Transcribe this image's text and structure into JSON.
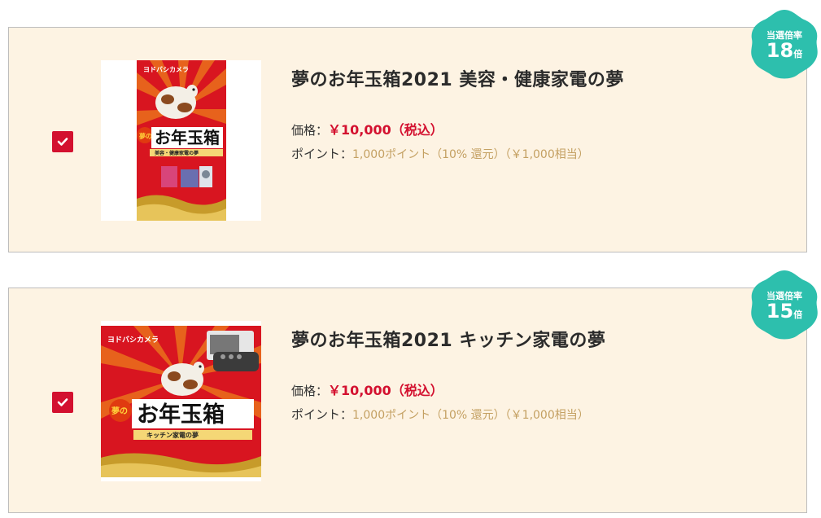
{
  "colors": {
    "accent_red": "#d3102f",
    "badge_teal": "#2dbfad",
    "card_bg": "#fdf3e3",
    "point_gold": "#c4a062"
  },
  "products": [
    {
      "checked": true,
      "title": "夢のお年玉箱2021 美容・健康家電の夢",
      "price_label": "価格：",
      "price_value": "￥10,000（税込）",
      "point_label": "ポイント：",
      "point_value": "1,000ポイント（10% 還元）（￥1,000相当）",
      "badge": {
        "label": "当選倍率",
        "number": "18",
        "unit": "倍"
      },
      "image": {
        "brand": "ヨドバシカメラ",
        "headline": "お年玉箱",
        "yume": "夢の",
        "subtitle": "美容・健康家電の夢"
      }
    },
    {
      "checked": true,
      "title": "夢のお年玉箱2021 キッチン家電の夢",
      "price_label": "価格：",
      "price_value": "￥10,000（税込）",
      "point_label": "ポイント：",
      "point_value": "1,000ポイント（10% 還元）（￥1,000相当）",
      "badge": {
        "label": "当選倍率",
        "number": "15",
        "unit": "倍"
      },
      "image": {
        "brand": "ヨドバシカメラ",
        "headline": "お年玉箱",
        "yume": "夢の",
        "subtitle": "キッチン家電の夢"
      }
    }
  ]
}
